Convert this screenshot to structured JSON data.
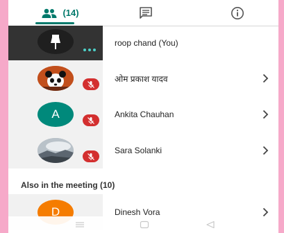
{
  "tabs": {
    "people_count": "(14)",
    "people_icon": "people-icon",
    "chat_icon": "chat-icon",
    "info_icon": "info-icon",
    "accent": "#00796b"
  },
  "participants": [
    {
      "name": "roop chand (You)",
      "avatar": "video-tile",
      "status": "speaking",
      "has_chevron": false
    },
    {
      "name": "ओम प्रकाश यादव",
      "avatar": "photo-panda",
      "status": "muted",
      "has_chevron": true
    },
    {
      "name": "Ankita Chauhan",
      "avatar": "initial",
      "initial": "A",
      "avatar_color": "#00897b",
      "status": "muted",
      "has_chevron": true
    },
    {
      "name": "Sara Solanki",
      "avatar": "photo-sky",
      "status": "muted",
      "has_chevron": true
    }
  ],
  "section": {
    "label": "Also in the meeting (10)"
  },
  "partial_participant": {
    "name": "Dinesh Vora",
    "initial": "D",
    "avatar_color": "#f57c00"
  },
  "colors": {
    "muted": "#d32f2f",
    "speaking": "#4dd0c8",
    "background": "#f6a9c9"
  }
}
